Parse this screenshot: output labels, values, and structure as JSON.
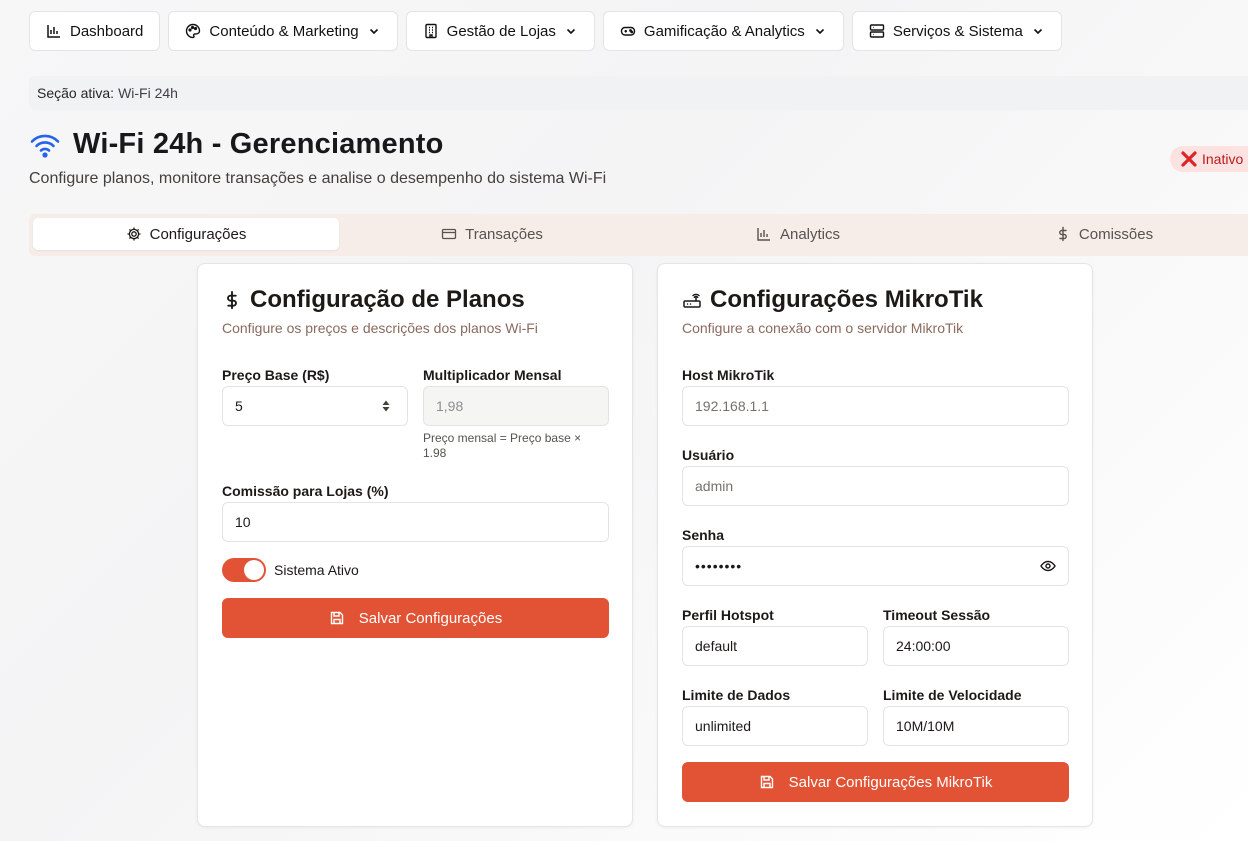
{
  "nav": {
    "dashboard": "Dashboard",
    "conteudo": "Conteúdo & Marketing",
    "gestao": "Gestão de Lojas",
    "gamificacao": "Gamificação & Analytics",
    "servicos": "Serviços & Sistema"
  },
  "section": {
    "label": "Seção ativa:",
    "value": "Wi-Fi 24h"
  },
  "header": {
    "title": "Wi-Fi 24h - Gerenciamento",
    "subtitle": "Configure planos, monitore transações e analise o desempenho do sistema Wi-Fi",
    "status": "Inativo",
    "status_icon": "x-mark-icon"
  },
  "tabs": [
    {
      "label": "Configurações",
      "icon": "gear-icon"
    },
    {
      "label": "Transações",
      "icon": "credit-card-icon"
    },
    {
      "label": "Analytics",
      "icon": "bar-chart-icon"
    },
    {
      "label": "Comissões",
      "icon": "dollar-icon"
    }
  ],
  "plans": {
    "title": "Configuração de Planos",
    "description": "Configure os preços e descrições dos planos Wi-Fi",
    "base_price_label": "Preço Base (R$)",
    "base_price_value": "5",
    "multiplier_label": "Multiplicador Mensal",
    "multiplier_value": "1,98",
    "multiplier_hint_1": "Preço mensal = Preço base ×",
    "multiplier_hint_2": "1.98",
    "commission_label": "Comissão para Lojas (%)",
    "commission_value": "10",
    "active_label": "Sistema Ativo",
    "active": true,
    "save_label": "Salvar Configurações"
  },
  "mikrotik": {
    "title": "Configurações MikroTik",
    "description": "Configure a conexão com o servidor MikroTik",
    "host_label": "Host MikroTik",
    "host_placeholder": "192.168.1.1",
    "user_label": "Usuário",
    "user_placeholder": "admin",
    "password_label": "Senha",
    "password_value": "••••••••",
    "profile_label": "Perfil Hotspot",
    "profile_value": "default",
    "timeout_label": "Timeout Sessão",
    "timeout_value": "24:00:00",
    "data_limit_label": "Limite de Dados",
    "data_limit_value": "unlimited",
    "speed_limit_label": "Limite de Velocidade",
    "speed_limit_value": "10M/10M",
    "save_label": "Salvar Configurações MikroTik"
  },
  "colors": {
    "accent": "#e15334",
    "wifi_icon": "#2563eb",
    "status_bg": "#fde2e2",
    "tabs_bg": "#f6ece8"
  }
}
